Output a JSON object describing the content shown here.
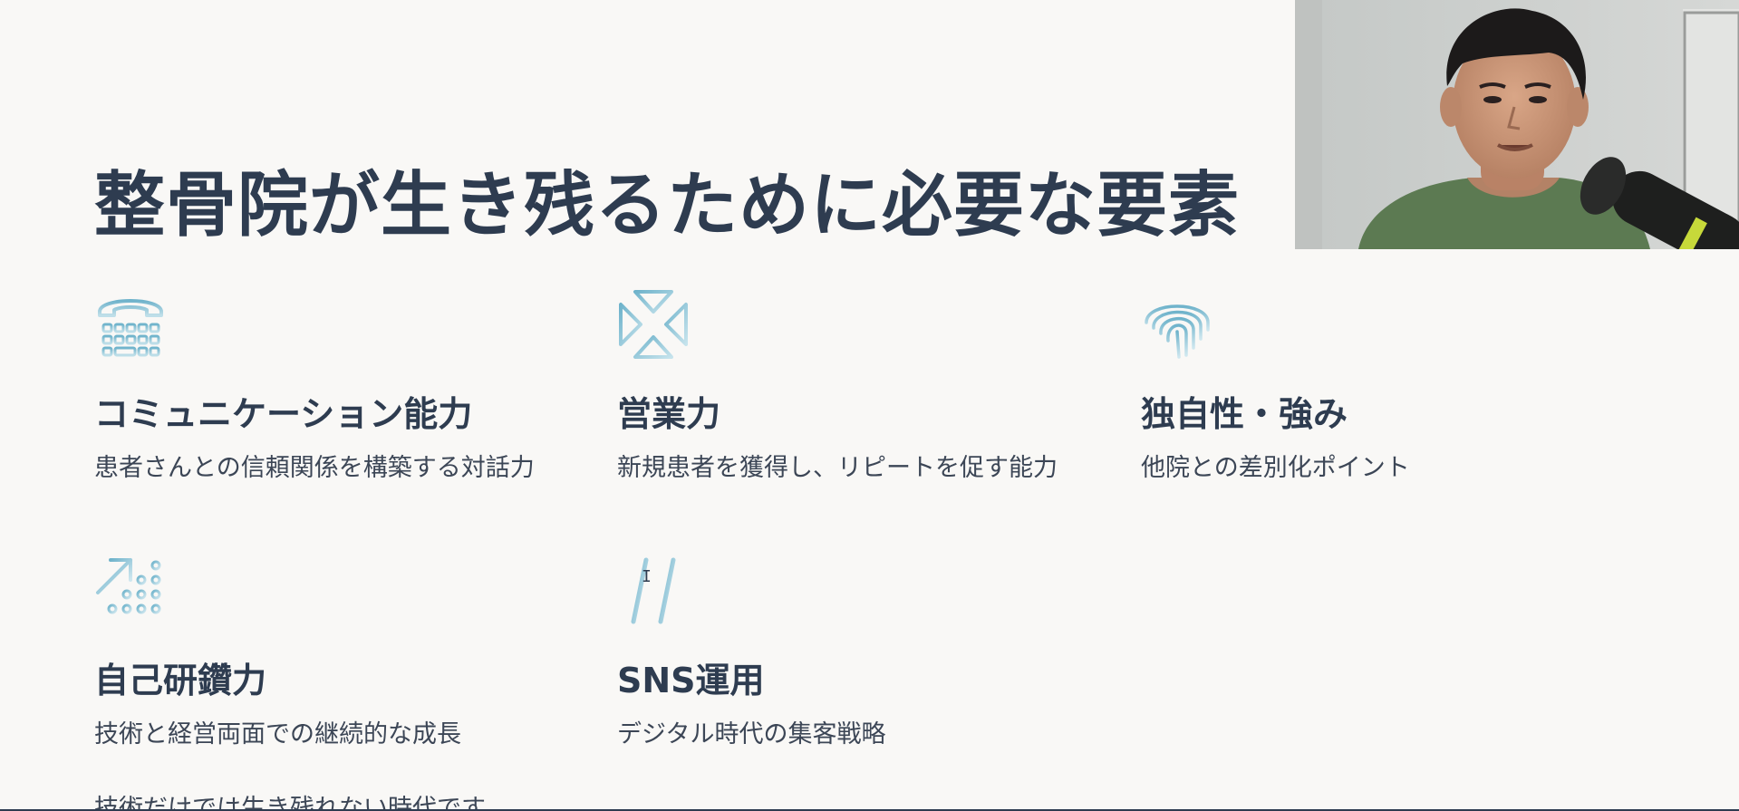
{
  "slide": {
    "title": "整骨院が生き残るために必要な要素",
    "features": [
      {
        "icon": "telephone-icon",
        "name": "コミュニケーション能力",
        "desc": "患者さんとの信頼関係を構築する対話力"
      },
      {
        "icon": "arrows-converge-icon",
        "name": "営業力",
        "desc": "新規患者を獲得し、リピートを促す能力"
      },
      {
        "icon": "fingerprint-icon",
        "name": "独自性・強み",
        "desc": "他院との差別化ポイント"
      },
      {
        "icon": "growth-arrow-icon",
        "name": "自己研鑽力",
        "desc": "技術と経営両面での継続的な成長"
      },
      {
        "icon": "hashtag-icon",
        "name": "SNS運用",
        "desc": "デジタル時代の集客戦略"
      }
    ],
    "footer_text": "技術だけでは生き残れない時代です"
  },
  "colors": {
    "background": "#f9f8f6",
    "text": "#2e3c50",
    "icon_accent": "#7dbcd1"
  },
  "webcam": {
    "presenter": "webcam-feed"
  }
}
